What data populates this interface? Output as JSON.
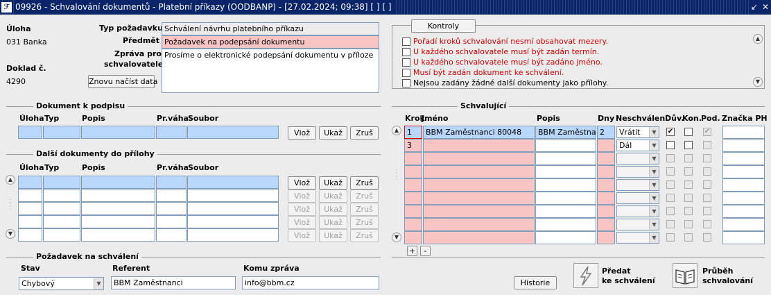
{
  "window": {
    "title": "09926 - Schvalování dokumentů - Platební příkazy (OODBANP) - [27.02.2024; 09:38]  [ ]  [ ]",
    "icon": "oracle-forms-icon",
    "ctl1": "↙",
    "ctl2": "✕"
  },
  "header": {
    "uloha_label": "Úloha",
    "uloha_value": "031 Banka",
    "doklad_label": "Doklad č.",
    "doklad_value": "4290",
    "typ_label": "Typ požadavku",
    "typ_value": "Schválení návrhu platebního příkazu",
    "predmet_label": "Předmět",
    "predmet_value": "Požadavek na podepsání dokumentu",
    "zprava_label1": "Zpráva pro",
    "zprava_label2": "schvalovatele",
    "zprava_value": "Prosíme o elektronické podepsání dokumentu v příloze",
    "reload_label": "Znovu načíst data"
  },
  "kontroly": {
    "button_label": "Kontroly",
    "messages": [
      {
        "text": "Pořadí kroků schvalování nesmí obsahovat mezery.",
        "color": "#d00000"
      },
      {
        "text": "U každého schvalovatele musí být zadán termín.",
        "color": "#d00000"
      },
      {
        "text": "U každého schvalovatele musí být zadáno jméno.",
        "color": "#d00000"
      },
      {
        "text": "Musí být zadán dokument ke schválení.",
        "color": "#d00000"
      },
      {
        "text": "Nejsou zadány žádné další dokumenty jako přílohy.",
        "color": "#000000"
      }
    ]
  },
  "doc": {
    "section": "Dokument k podpisu",
    "cols": [
      "Úloha",
      "Typ",
      "Popis",
      "Pr.váha",
      "Soubor"
    ],
    "btn_vloz": "Vlož",
    "btn_ukaz": "Ukaž",
    "btn_zrus": "Zruš"
  },
  "dalsi": {
    "section": "Další dokumenty do přílohy",
    "cols": [
      "Úloha",
      "Typ",
      "Popis",
      "Pr.váha",
      "Soubor"
    ],
    "btn_vloz": "Vlož",
    "btn_ukaz": "Ukaž",
    "btn_zrus": "Zruš"
  },
  "schvalujici": {
    "section": "Schvalující",
    "cols": [
      "Krok",
      "Jméno",
      "Popis",
      "Dny",
      "Neschválení",
      "Dův.",
      "Kon.",
      "Pod.",
      "Značka PH"
    ],
    "rows": [
      {
        "krok": "1",
        "jmeno": "BBM Zaměstnanci 80048",
        "popis": "BBM Zaměstnanc",
        "dny": "2",
        "neschvaleni": "Vrátit",
        "duv": true,
        "kon": false,
        "pod": true
      },
      {
        "krok": "3",
        "jmeno": "",
        "popis": "",
        "dny": "",
        "neschvaleni": "Dál",
        "duv": false,
        "kon": false,
        "pod": false
      }
    ],
    "plus": "+",
    "minus": "-"
  },
  "pozadavek": {
    "section": "Požadavek na schválení",
    "stav_label": "Stav",
    "stav_value": "Chybový",
    "referent_label": "Referent",
    "referent_value": "BBM Zaměstnanci",
    "komu_label": "Komu zpráva",
    "komu_value": "info@bbm.cz"
  },
  "footer": {
    "historie": "Historie",
    "predat1": "Předat",
    "predat2": "ke schválení",
    "prubeh1": "Průběh",
    "prubeh2": "schvalování"
  }
}
